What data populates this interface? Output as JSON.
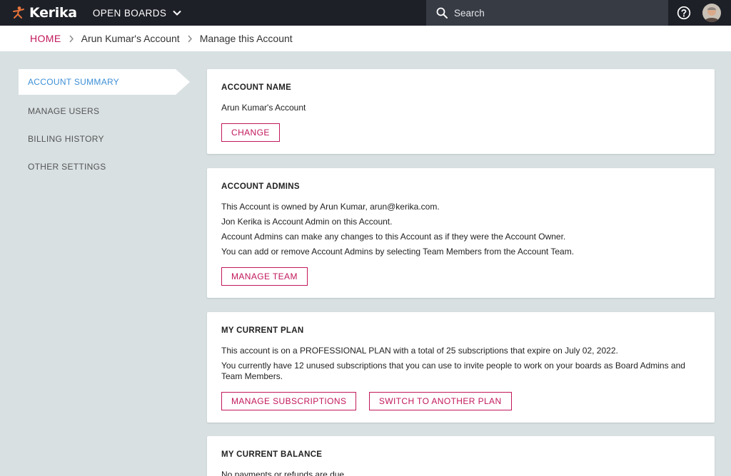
{
  "app": {
    "logo_text": "Kerika"
  },
  "topbar": {
    "open_boards_label": "OPEN BOARDS",
    "search_placeholder": "Search"
  },
  "breadcrumb": {
    "home": "HOME",
    "account": "Arun Kumar's Account",
    "current": "Manage this Account"
  },
  "sidenav": {
    "items": [
      {
        "label": "ACCOUNT SUMMARY",
        "active": true
      },
      {
        "label": "MANAGE USERS"
      },
      {
        "label": "BILLING HISTORY"
      },
      {
        "label": "OTHER SETTINGS"
      }
    ]
  },
  "account_name": {
    "title": "ACCOUNT NAME",
    "value": "Arun Kumar's Account",
    "button": "CHANGE"
  },
  "account_admins": {
    "title": "ACCOUNT ADMINS",
    "lines": [
      "This Account is owned by Arun Kumar, arun@kerika.com.",
      "Jon Kerika is Account Admin on this Account.",
      "Account Admins can make any changes to this Account as if they were the Account Owner.",
      "You can add or remove Account Admins by selecting Team Members from the Account Team."
    ],
    "button": "MANAGE TEAM"
  },
  "current_plan": {
    "title": "MY CURRENT PLAN",
    "lines": [
      "This account is on a PROFESSIONAL PLAN with a total of 25 subscriptions that expire on July 02, 2022.",
      "You currently have 12 unused subscriptions that you can use to invite people to work on your boards as Board Admins and Team Members."
    ],
    "buttons": [
      "MANAGE SUBSCRIPTIONS",
      "SWITCH TO ANOTHER PLAN"
    ]
  },
  "current_balance": {
    "title": "MY CURRENT BALANCE",
    "lines": [
      "No payments or refunds are due."
    ]
  },
  "colors": {
    "accent": "#c2185b",
    "active_nav": "#3d8fd6",
    "topbar": "#1d2027",
    "background": "#d8e0e2"
  }
}
